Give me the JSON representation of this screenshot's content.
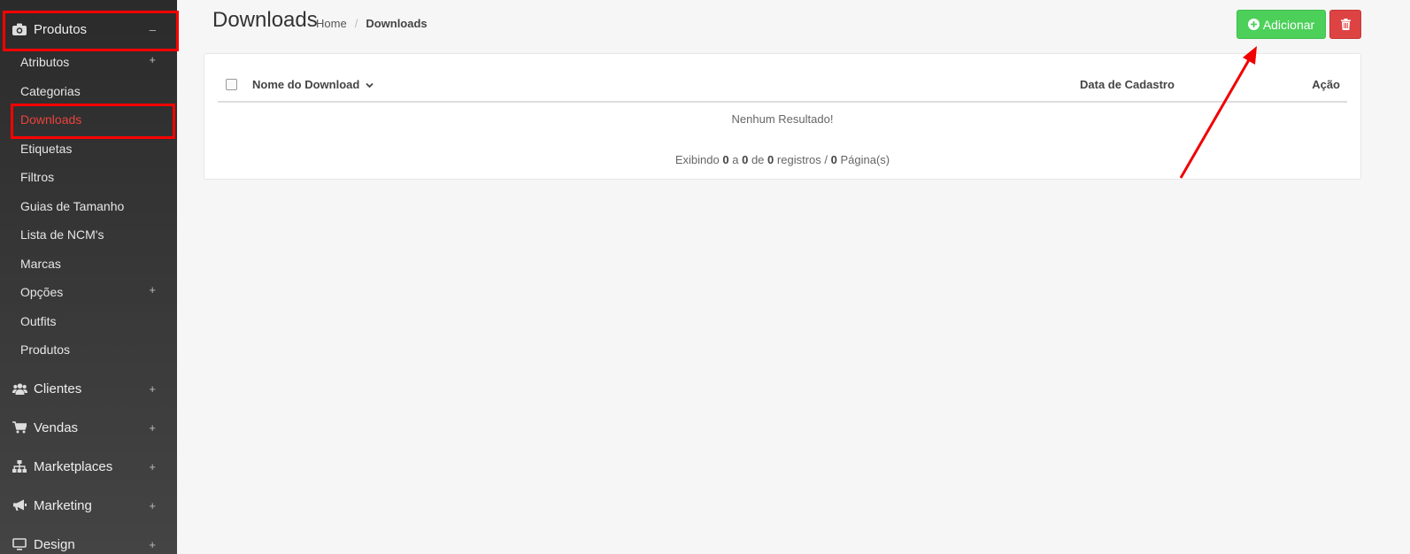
{
  "sidebar": {
    "produtos": {
      "label": "Produtos",
      "toggle": "–"
    },
    "items": [
      {
        "label": "Atributos",
        "toggle": "+"
      },
      {
        "label": "Categorias",
        "toggle": ""
      },
      {
        "label": "Downloads",
        "toggle": ""
      },
      {
        "label": "Etiquetas",
        "toggle": ""
      },
      {
        "label": "Filtros",
        "toggle": ""
      },
      {
        "label": "Guias de Tamanho",
        "toggle": ""
      },
      {
        "label": "Lista de NCM's",
        "toggle": ""
      },
      {
        "label": "Marcas",
        "toggle": ""
      },
      {
        "label": "Opções",
        "toggle": "+"
      },
      {
        "label": "Outfits",
        "toggle": ""
      },
      {
        "label": "Produtos",
        "toggle": ""
      }
    ],
    "sections": [
      {
        "label": "Clientes",
        "toggle": "+",
        "icon": "users-icon"
      },
      {
        "label": "Vendas",
        "toggle": "+",
        "icon": "cart-icon"
      },
      {
        "label": "Marketplaces",
        "toggle": "+",
        "icon": "sitemap-icon"
      },
      {
        "label": "Marketing",
        "toggle": "+",
        "icon": "megaphone-icon"
      },
      {
        "label": "Design",
        "toggle": "+",
        "icon": "monitor-icon"
      }
    ],
    "active_item": "Downloads"
  },
  "header": {
    "title": "Downloads",
    "breadcrumb": {
      "home": "Home",
      "separator": "/",
      "current": "Downloads"
    },
    "add_label": "Adicionar"
  },
  "table": {
    "columns": {
      "name": "Nome do Download",
      "date": "Data de Cadastro",
      "action": "Ação"
    },
    "sort_indicator": "⌄",
    "empty_message": "Nenhum Resultado!",
    "pager": {
      "prefix": "Exibindo",
      "from": "0",
      "a": "a",
      "to": "0",
      "de": "de",
      "total": "0",
      "registros": "registros /",
      "pages": "0",
      "paginas": "Página(s)"
    }
  },
  "colors": {
    "accent_red": "#e8433d",
    "add_green": "#4cd05a",
    "delete_red": "#dd4343",
    "highlight": "#ff0000"
  }
}
